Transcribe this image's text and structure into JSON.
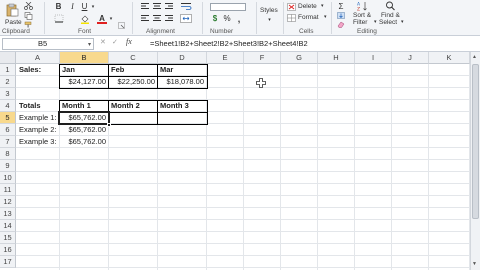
{
  "ribbon": {
    "clipboard": {
      "paste_label": "Paste",
      "group_label": "Clipboard"
    },
    "font": {
      "bold": "B",
      "italic": "I",
      "underline": "U",
      "font_color_glyph": "A",
      "group_label": "Font"
    },
    "alignment": {
      "group_label": "Alignment"
    },
    "number": {
      "currency_glyph": "$",
      "percent_glyph": "%",
      "comma_glyph": ",",
      "group_label": "Number"
    },
    "styles": {
      "styles_label": "Styles"
    },
    "cells": {
      "delete_label": "Delete",
      "format_label": "Format",
      "group_label": "Cells",
      "delete_arrow": "▾",
      "format_arrow": "▾"
    },
    "editing": {
      "sigma": "Σ",
      "sort_label": "Sort &",
      "filter_label": "Filter",
      "find_label": "Find &",
      "select_label": "Select",
      "group_label": "Editing"
    }
  },
  "formula_bar": {
    "name_box": "B5",
    "formula": "=Sheet1!B2+Sheet2!B2+Sheet3!B2+Sheet4!B2"
  },
  "grid": {
    "columns": [
      "A",
      "B",
      "C",
      "D",
      "E",
      "F",
      "G",
      "H",
      "I",
      "J",
      "K"
    ],
    "rows": [
      "1",
      "2",
      "3",
      "4",
      "5",
      "6",
      "7",
      "8",
      "9",
      "10",
      "11",
      "12",
      "13",
      "14",
      "15",
      "16",
      "17"
    ],
    "selected_column": "B",
    "selected_row": "5",
    "cells": {
      "A1": "Sales:",
      "B1": "Jan",
      "C1": "Feb",
      "D1": "Mar",
      "B2": "$24,127.00",
      "C2": "$22,250.00",
      "D2": "$18,078.00",
      "A4": "Totals",
      "B4": "Month 1",
      "C4": "Month 2",
      "D4": "Month 3",
      "A5": "Example 1:",
      "B5": "$65,762.00",
      "A6": "Example 2:",
      "B6": "$65,762.00",
      "A7": "Example 3:",
      "B7": "$65,762.00"
    }
  },
  "colors": {
    "selection_header": "#f8d98d",
    "grid_line": "#e3e6ea"
  }
}
